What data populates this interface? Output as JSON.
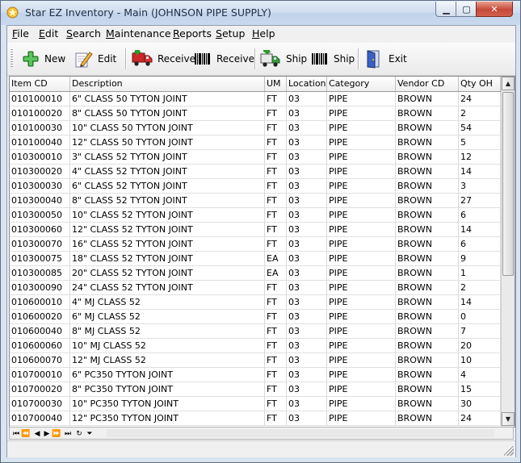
{
  "window": {
    "title": "Star EZ Inventory - Main (JOHNSON PIPE SUPPLY)"
  },
  "menu": [
    "File",
    "Edit",
    "Search",
    "Maintenance",
    "Reports",
    "Setup",
    "Help"
  ],
  "toolbar": {
    "new_label": "New",
    "edit_label": "Edit",
    "receive_label": "Receive",
    "receive_scan_label": "Receive",
    "ship_label": "Ship",
    "ship_scan_label": "Ship",
    "exit_label": "Exit"
  },
  "grid": {
    "columns": [
      "Item CD",
      "Description",
      "UM",
      "Location",
      "Category",
      "Vendor CD",
      "Qty OH"
    ],
    "rows": [
      [
        "010100010",
        "6\" CLASS 50 TYTON JOINT",
        "FT",
        "03",
        "PIPE",
        "BROWN",
        "24"
      ],
      [
        "010100020",
        "8\" CLASS 50 TYTON JOINT",
        "FT",
        "03",
        "PIPE",
        "BROWN",
        "2"
      ],
      [
        "010100030",
        "10\" CLASS 50 TYTON JOINT",
        "FT",
        "03",
        "PIPE",
        "BROWN",
        "54"
      ],
      [
        "010100040",
        "12\" CLASS 50 TYTON JOINT",
        "FT",
        "03",
        "PIPE",
        "BROWN",
        "5"
      ],
      [
        "010300010",
        "3\" CLASS 52 TYTON JOINT",
        "FT",
        "03",
        "PIPE",
        "BROWN",
        "12"
      ],
      [
        "010300020",
        "4\" CLASS 52 TYTON JOINT",
        "FT",
        "03",
        "PIPE",
        "BROWN",
        "14"
      ],
      [
        "010300030",
        "6\" CLASS 52 TYTON JOINT",
        "FT",
        "03",
        "PIPE",
        "BROWN",
        "3"
      ],
      [
        "010300040",
        "8\" CLASS 52 TYTON JOINT",
        "FT",
        "03",
        "PIPE",
        "BROWN",
        "27"
      ],
      [
        "010300050",
        "10\" CLASS 52 TYTON JOINT",
        "FT",
        "03",
        "PIPE",
        "BROWN",
        "6"
      ],
      [
        "010300060",
        "12\" CLASS 52 TYTON JOINT",
        "FT",
        "03",
        "PIPE",
        "BROWN",
        "14"
      ],
      [
        "010300070",
        "16\" CLASS 52 TYTON JOINT",
        "FT",
        "03",
        "PIPE",
        "BROWN",
        "6"
      ],
      [
        "010300075",
        "18\" CLASS 52 TYTON JOINT",
        "EA",
        "03",
        "PIPE",
        "BROWN",
        "9"
      ],
      [
        "010300085",
        "20\" CLASS 52 TYTON JOINT",
        "EA",
        "03",
        "PIPE",
        "BROWN",
        "1"
      ],
      [
        "010300090",
        "24\" CLASS 52 TYTON JOINT",
        "FT",
        "03",
        "PIPE",
        "BROWN",
        "2"
      ],
      [
        "010600010",
        "4\" MJ CLASS 52",
        "FT",
        "03",
        "PIPE",
        "BROWN",
        "14"
      ],
      [
        "010600020",
        "6\" MJ CLASS 52",
        "FT",
        "03",
        "PIPE",
        "BROWN",
        "0"
      ],
      [
        "010600040",
        "8\" MJ CLASS 52",
        "FT",
        "03",
        "PIPE",
        "BROWN",
        "7"
      ],
      [
        "010600060",
        "10\" MJ CLASS 52",
        "FT",
        "03",
        "PIPE",
        "BROWN",
        "20"
      ],
      [
        "010600070",
        "12\" MJ CLASS 52",
        "FT",
        "03",
        "PIPE",
        "BROWN",
        "10"
      ],
      [
        "010700010",
        "6\" PC350 TYTON JOINT",
        "FT",
        "03",
        "PIPE",
        "BROWN",
        "4"
      ],
      [
        "010700020",
        "8\" PC350 TYTON JOINT",
        "FT",
        "03",
        "PIPE",
        "BROWN",
        "15"
      ],
      [
        "010700030",
        "10\" PC350 TYTON JOINT",
        "FT",
        "03",
        "PIPE",
        "BROWN",
        "30"
      ],
      [
        "010700040",
        "12\" PC350 TYTON JOINT",
        "FT",
        "03",
        "PIPE",
        "BROWN",
        "24"
      ]
    ]
  },
  "colors": {
    "title_bg": "#cfdcef",
    "close_red": "#c6493a",
    "grid_border": "#8a8a8a"
  },
  "icons": [
    "app-icon",
    "plus-icon",
    "pencil-icon",
    "truck-receive-icon",
    "barcode-icon",
    "truck-ship-icon",
    "barcode-icon",
    "exit-door-icon"
  ]
}
